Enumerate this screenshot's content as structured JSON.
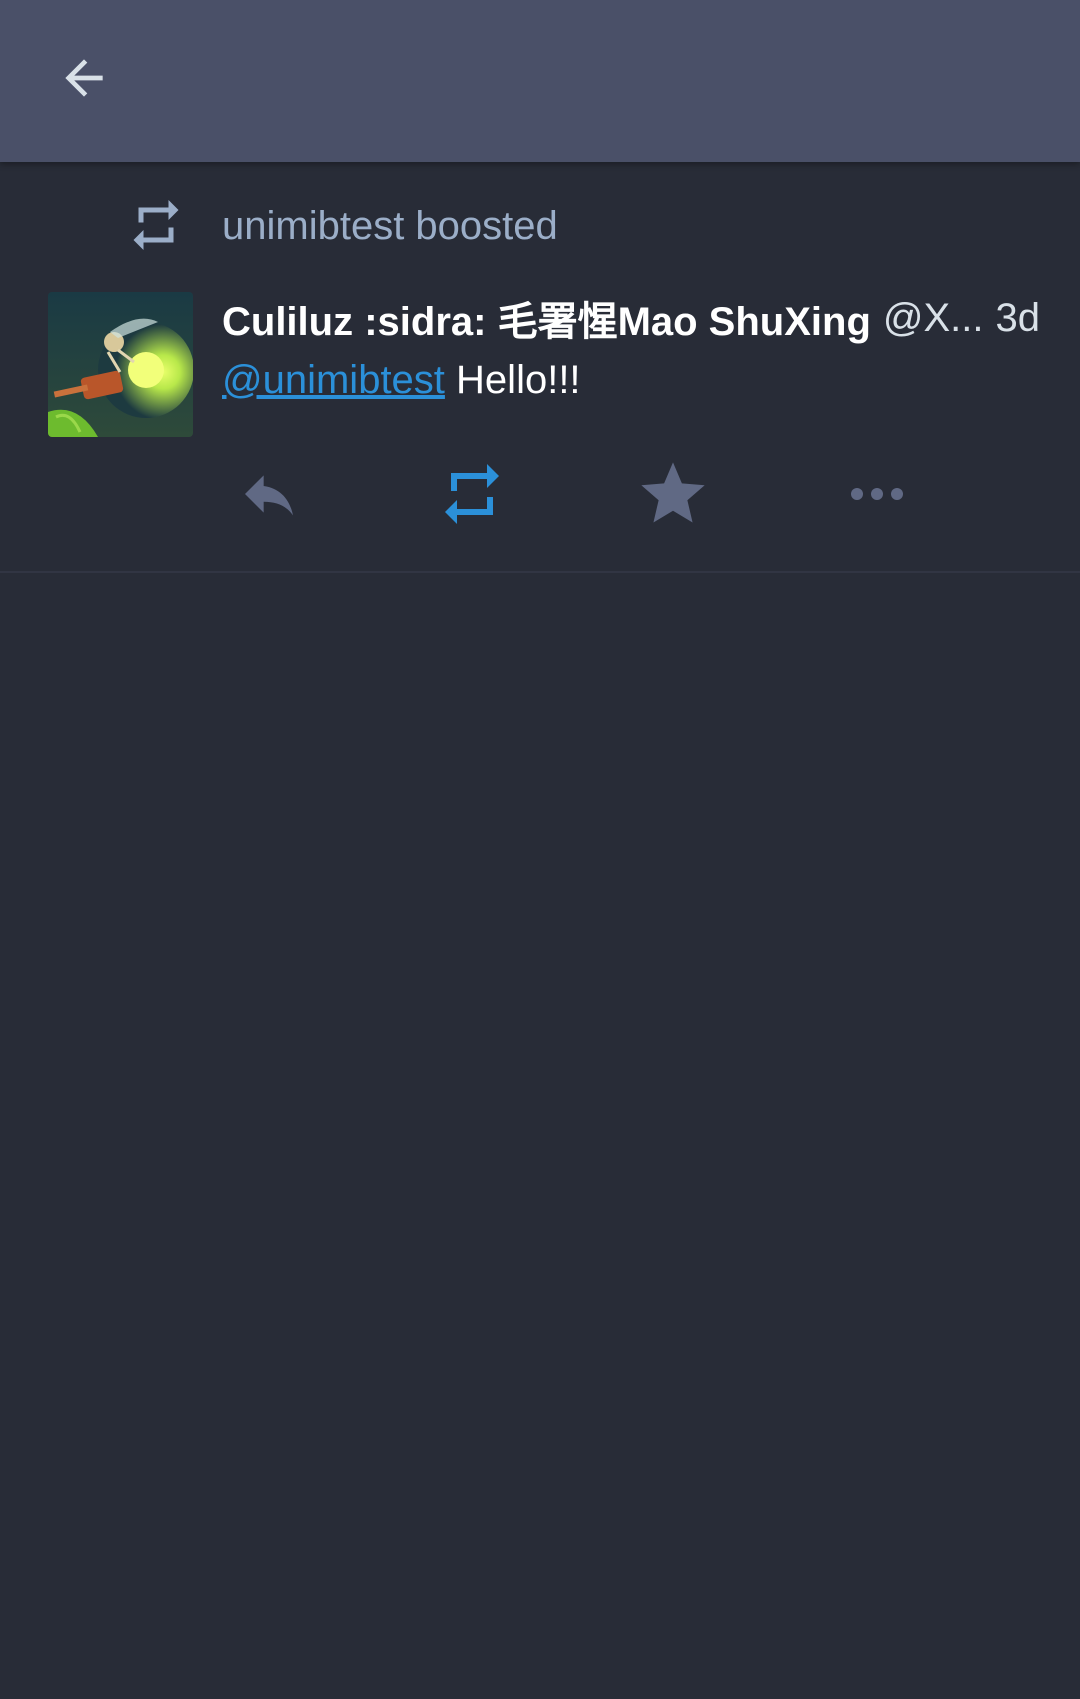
{
  "toolbar": {
    "back_icon": "arrow-left-icon"
  },
  "status": {
    "boost_label": "unimibtest boosted",
    "author": {
      "display_name": "Culiluz :sidra: 毛署惺Mao ShuXing",
      "handle": "@X...",
      "avatar_icon": "avatar-image"
    },
    "timestamp": "3d",
    "content": {
      "mention": "@unimibtest",
      "text": "Hello!!!"
    },
    "actions": {
      "reply_icon": "reply-icon",
      "boost_icon": "boost-icon",
      "favourite_icon": "star-icon",
      "more_icon": "more-icon"
    }
  },
  "colors": {
    "background": "#282c37",
    "toolbar": "#4a5068",
    "accent": "#2b90d9",
    "muted": "#9baec8",
    "action_icon": "#606984"
  }
}
